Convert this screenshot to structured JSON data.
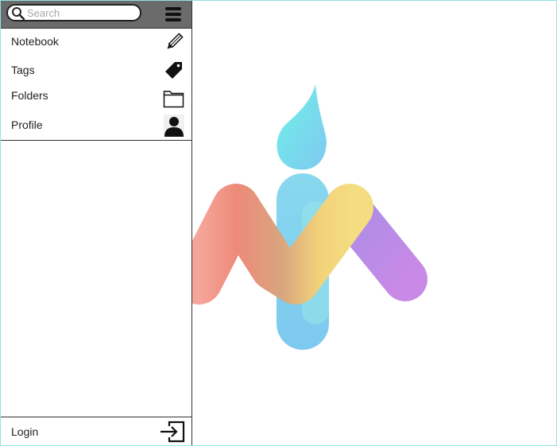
{
  "search": {
    "placeholder": "Search"
  },
  "nav": {
    "items": [
      {
        "label": "Notebook",
        "icon": "pencil-icon"
      },
      {
        "label": "Tags",
        "icon": "tag-icon"
      },
      {
        "label": "Folders",
        "icon": "folder-icon"
      },
      {
        "label": "Profile",
        "icon": "user-icon"
      }
    ],
    "login_label": "Login",
    "login_icon": "login-icon"
  },
  "colors": {
    "topbar": "#6b6b6b",
    "logo_blue": "#7fd3ee",
    "logo_red": "#ef8a7c",
    "logo_yellow": "#f2d27a",
    "logo_purple": "#b48ae8",
    "frame_border": "#8fe3e6"
  }
}
